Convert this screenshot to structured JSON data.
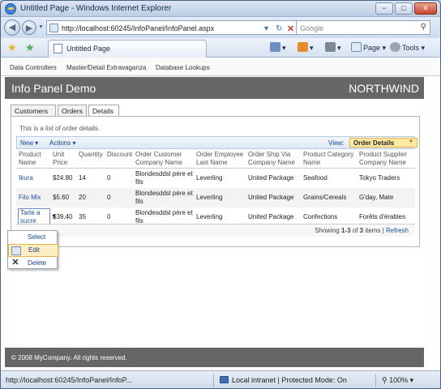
{
  "window": {
    "title": "Untitled Page - Windows Internet Explorer",
    "buttons": [
      "−",
      "□",
      "✕"
    ]
  },
  "addressbar": {
    "url": "http://localhost:60245/InfoPanel/InfoPanel.aspx",
    "search_placeholder": "Google"
  },
  "commandbar": {
    "tab_title": "Untitled Page",
    "page_label": "Page",
    "tools_label": "Tools"
  },
  "site": {
    "menu": [
      "Data Controllers",
      "Master/Detail Extravaganza",
      "Database Lookups"
    ],
    "title": "Info Panel Demo",
    "brand": "NORTHWIND",
    "tabs": [
      "Customers",
      "Orders",
      "Details"
    ],
    "active_tab": "Details",
    "footer": "© 2008 MyCompany. All rights reserved."
  },
  "panel": {
    "description": "This is a list of order details.",
    "new_label": "New",
    "actions_label": "Actions",
    "view_label": "View:",
    "view_value": "Order Details",
    "columns": [
      [
        "Product",
        "Name"
      ],
      [
        "Unit",
        "Price"
      ],
      [
        "Quantity"
      ],
      [
        "Discount"
      ],
      [
        "Order Customer",
        "Company Name"
      ],
      [
        "Order Employee",
        "Last Name"
      ],
      [
        "Order Ship Via",
        "Company Name"
      ],
      [
        "Product Category",
        "Name"
      ],
      [
        "Product Supplier",
        "Company Name"
      ]
    ],
    "rows": [
      {
        "product": [
          "Ikura"
        ],
        "price": "$24.80",
        "qty": "14",
        "discount": "0",
        "customer": [
          "Blondesddsl père et",
          "fils"
        ],
        "employee": "Leverling",
        "shipvia": "United Package",
        "category": "Seafood",
        "supplier": "Tokyo Traders"
      },
      {
        "product": [
          "Filo Mix"
        ],
        "price": "$5.60",
        "qty": "20",
        "discount": "0",
        "customer": [
          "Blondesddsl père et",
          "fils"
        ],
        "employee": "Leverling",
        "shipvia": "United Package",
        "category": "Grains/Cereals",
        "supplier": "G'day, Mate"
      },
      {
        "product": [
          "Tarte a",
          "sucre"
        ],
        "price": "$39.40",
        "qty": "35",
        "discount": "0",
        "customer": [
          "Blondesddsl père et",
          "fils"
        ],
        "employee": "Leverling",
        "shipvia": "United Package",
        "category": "Confections",
        "supplier": "Forêts d'érables"
      }
    ],
    "pager": {
      "prefix": "Showing ",
      "range": "1-3",
      "middle": " of ",
      "total": "3",
      "suffix": " items | ",
      "refresh": "Refresh"
    }
  },
  "context_menu": {
    "items": [
      {
        "label": "Select",
        "icon": "none"
      },
      {
        "label": "Edit",
        "icon": "edit-icon"
      },
      {
        "label": "Delete",
        "icon": "delete-icon"
      }
    ],
    "highlighted": "Edit"
  },
  "statusbar": {
    "url": "http://localhost:60245/InfoPanel/InfoP...",
    "zone": "Local intranet | Protected Mode: On",
    "zoom": "100%"
  }
}
